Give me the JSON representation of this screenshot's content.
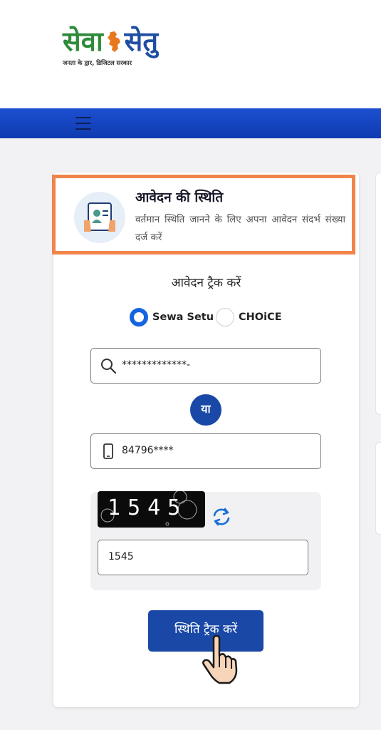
{
  "header": {
    "logo_sewa": "सेवा",
    "logo_setu": "सेतु",
    "logo_tagline": "जनता के द्वार, डिजिटल सरकार"
  },
  "status": {
    "title": "आवेदन की स्थिति",
    "description": "वर्तमान स्थिति जानने के लिए अपना आवेदन संदर्भ संख्या दर्ज करें"
  },
  "track": {
    "heading": "आवेदन ट्रैक करें",
    "options": [
      {
        "label": "Sewa Setu",
        "selected": true
      },
      {
        "label": "CHOiCE",
        "selected": false
      }
    ],
    "reference_value": "*************-",
    "or_label": "या",
    "mobile_value": "84796****",
    "captcha_text": "1545",
    "captcha_input_value": "1545",
    "submit_label": "स्थिति ट्रैक करें"
  },
  "colors": {
    "primary": "#1a48a6",
    "nav": "#1d4fd0",
    "highlight": "#f0844a",
    "radio": "#1565e0",
    "logo_green": "#2e8b3a"
  }
}
